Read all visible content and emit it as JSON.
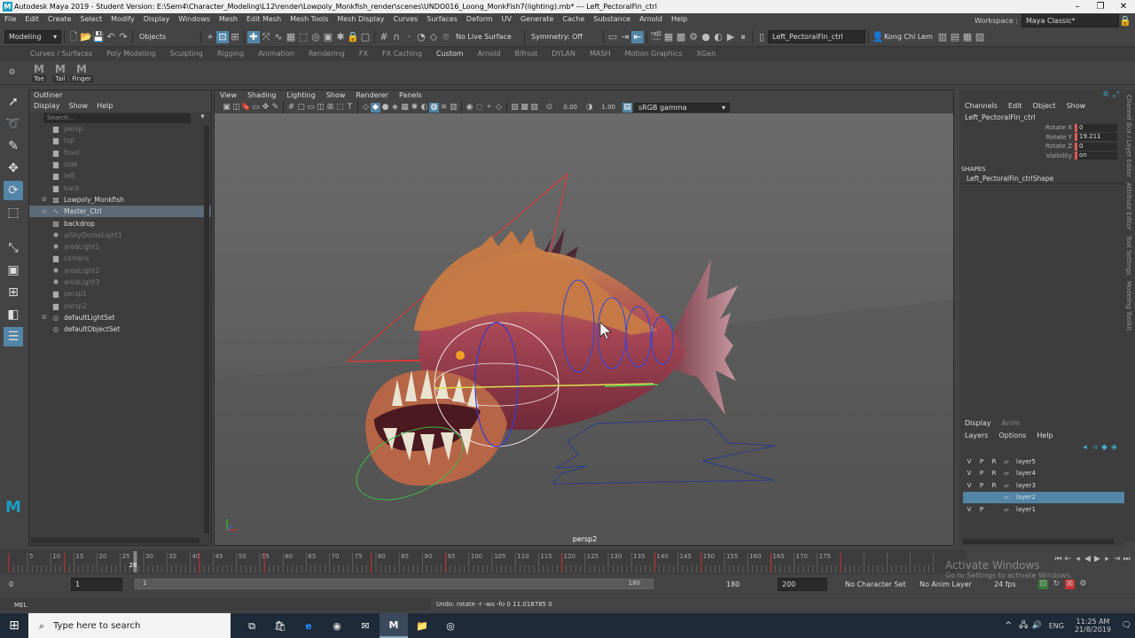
{
  "window": {
    "title": "Autodesk Maya 2019 - Student Version: E:\\Sem4\\Character_Modeling\\L12\\render\\Lowpoly_Monkfish_render\\scenes\\UNDO016_Loong_MonkFish7(lighting).mb*  ---  Left_PectoralFin_ctrl"
  },
  "menubar": {
    "items": [
      "File",
      "Edit",
      "Create",
      "Select",
      "Modify",
      "Display",
      "Windows",
      "Mesh",
      "Edit Mesh",
      "Mesh Tools",
      "Mesh Display",
      "Curves",
      "Surfaces",
      "Deform",
      "UV",
      "Generate",
      "Cache",
      "Substance",
      "Arnold",
      "Help"
    ],
    "workspace_label": "Workspace :",
    "workspace_value": "Maya Classic*"
  },
  "statusline": {
    "menuset": "Modeling",
    "objects_label": "Objects",
    "live_surface": "No Live Surface",
    "symmetry": "Symmetry: Off",
    "selection_field": "Left_PectoralFin_ctrl",
    "user": "Kong Chi Lem"
  },
  "shelf": {
    "tabs": [
      "Curves / Surfaces",
      "Poly Modeling",
      "Sculpting",
      "Rigging",
      "Animation",
      "Rendering",
      "FX",
      "FX Caching",
      "Custom",
      "Arnold",
      "Bifrost",
      "DYLAN",
      "MASH",
      "Motion Graphics",
      "XGen"
    ],
    "active_tab": "Custom",
    "buttons": [
      "Toe",
      "Tail",
      "Finger"
    ]
  },
  "outliner": {
    "title": "Outliner",
    "menu": [
      "Display",
      "Show",
      "Help"
    ],
    "search_placeholder": "Search...",
    "items": [
      {
        "label": "persp",
        "icon": "camera-icon",
        "dim": true,
        "expand": ""
      },
      {
        "label": "top",
        "icon": "camera-icon",
        "dim": true,
        "expand": ""
      },
      {
        "label": "front",
        "icon": "camera-icon",
        "dim": true,
        "expand": ""
      },
      {
        "label": "side",
        "icon": "camera-icon",
        "dim": true,
        "expand": ""
      },
      {
        "label": "left",
        "icon": "camera-icon",
        "dim": true,
        "expand": ""
      },
      {
        "label": "back",
        "icon": "camera-icon",
        "dim": true,
        "expand": ""
      },
      {
        "label": "Lowpoly_Monkfish",
        "icon": "mesh-icon",
        "dim": false,
        "expand": "⊞"
      },
      {
        "label": "Master_Ctrl",
        "icon": "curve-icon",
        "dim": false,
        "expand": "⊞",
        "selected": true
      },
      {
        "label": "backdrop",
        "icon": "mesh-icon",
        "dim": false,
        "expand": ""
      },
      {
        "label": "aiSkyDomeLight1",
        "icon": "light-icon",
        "dim": true,
        "expand": ""
      },
      {
        "label": "areaLight1",
        "icon": "light-icon",
        "dim": true,
        "expand": ""
      },
      {
        "label": "camera",
        "icon": "camera-icon",
        "dim": true,
        "expand": ""
      },
      {
        "label": "areaLight2",
        "icon": "light-icon",
        "dim": true,
        "expand": ""
      },
      {
        "label": "areaLight3",
        "icon": "light-icon",
        "dim": true,
        "expand": ""
      },
      {
        "label": "persp1",
        "icon": "camera-icon",
        "dim": true,
        "expand": ""
      },
      {
        "label": "persp2",
        "icon": "camera-icon",
        "dim": true,
        "expand": ""
      },
      {
        "label": "defaultLightSet",
        "icon": "set-icon",
        "dim": false,
        "expand": "⊞"
      },
      {
        "label": "defaultObjectSet",
        "icon": "set-icon",
        "dim": false,
        "expand": ""
      }
    ]
  },
  "viewport": {
    "menu": [
      "View",
      "Shading",
      "Lighting",
      "Show",
      "Renderer",
      "Panels"
    ],
    "exposure": "0.00",
    "gamma": "1.00",
    "colorspace": "sRGB gamma",
    "camera": "persp2"
  },
  "channelbox": {
    "menu": [
      "Channels",
      "Edit",
      "Object",
      "Show"
    ],
    "object_name": "Left_PectoralFin_ctrl",
    "attributes": [
      {
        "name": "Rotate X",
        "value": "0"
      },
      {
        "name": "Rotate Y",
        "value": "19.211"
      },
      {
        "name": "Rotate Z",
        "value": "0"
      },
      {
        "name": "Visibility",
        "value": "on"
      }
    ],
    "shapes_label": "SHAPES",
    "shape_name": "Left_PectoralFin_ctrlShape"
  },
  "sidetabs": [
    "Channel Box / Layer Editor",
    "Attribute Editor",
    "Tool Settings",
    "Modeling Toolkit"
  ],
  "layereditor": {
    "tabs": [
      "Display",
      "Anim"
    ],
    "menu": [
      "Layers",
      "Options",
      "Help"
    ],
    "layers": [
      {
        "v": "V",
        "p": "P",
        "r": "R",
        "name": "layer5",
        "selected": false
      },
      {
        "v": "V",
        "p": "P",
        "r": "R",
        "name": "layer4",
        "selected": false
      },
      {
        "v": "V",
        "p": "P",
        "r": "R",
        "name": "layer3",
        "selected": false
      },
      {
        "v": "",
        "p": "",
        "r": "",
        "name": "layer2",
        "selected": true
      },
      {
        "v": "V",
        "p": "P",
        "r": "",
        "name": "layer1",
        "selected": false
      }
    ]
  },
  "timeslider": {
    "ticks": [
      "5",
      "10",
      "15",
      "20",
      "25",
      "30",
      "35",
      "40",
      "45",
      "50",
      "55",
      "60",
      "65",
      "70",
      "75",
      "80",
      "85",
      "90",
      "95",
      "100",
      "105",
      "110",
      "115",
      "120",
      "125",
      "130",
      "135",
      "140",
      "145",
      "150",
      "155",
      "160",
      "165",
      "170",
      "175"
    ],
    "current_frame": "28"
  },
  "rangeslider": {
    "start": "0",
    "range_start": "1",
    "range_handle_start": "1",
    "range_handle_end": "180",
    "range_end": "180",
    "end": "200",
    "character_set": "No Character Set",
    "anim_layer": "No Anim Layer",
    "fps": "24 fps"
  },
  "cmdline": {
    "lang": "MEL",
    "feedback": "Undo: rotate -r -ws -fo 0 11.018785 0"
  },
  "watermark": {
    "line1": "Activate Windows",
    "line2": "Go to Settings to activate Windows."
  },
  "taskbar": {
    "search_placeholder": "Type here to search",
    "lang": "ENG",
    "time": "11:25 AM",
    "date": "21/8/2019"
  }
}
